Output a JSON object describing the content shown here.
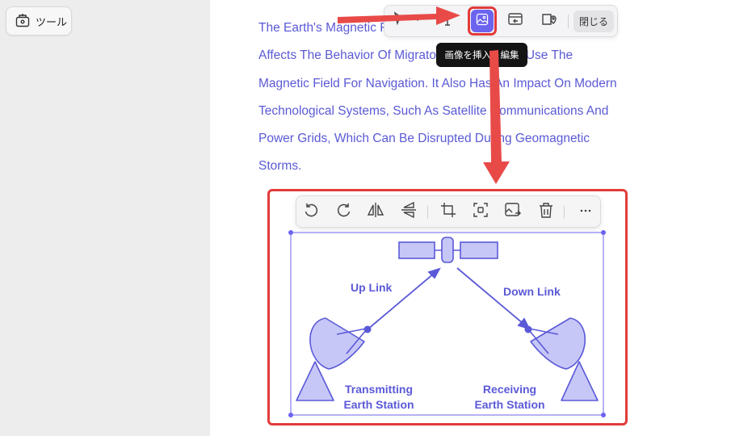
{
  "sidebar": {
    "tools_label": "ツール"
  },
  "document": {
    "paragraph_lines": [
      "The Earth's Magnetic Field Is Also Important Because It",
      "Affects The Behavior Of Migratory Animals That Use The",
      "Magnetic Field For Navigation. It Also Has An Impact On Modern",
      "Technological Systems, Such As Satellite Communications And",
      "Power Grids, Which Can Be Disrupted During Geomagnetic",
      "Storms."
    ]
  },
  "top_toolbar": {
    "tools": [
      "select-icon",
      "text-icon",
      "image-icon",
      "link-icon",
      "location-pin-icon"
    ],
    "close_label": "閉じる"
  },
  "tooltip": {
    "text": "画像を挿入＆編集"
  },
  "image_toolbar": {
    "tools": [
      "rotate-left-icon",
      "rotate-right-icon",
      "flip-horizontal-icon",
      "flip-vertical-icon",
      "crop-icon",
      "extract-icon",
      "replace-icon",
      "delete-icon",
      "more-icon"
    ]
  },
  "diagram": {
    "uplink_label": "Up Link",
    "downlink_label": "Down Link",
    "transmitting_line1": "Transmitting",
    "transmitting_line2": "Earth Station",
    "receiving_line1": "Receiving",
    "receiving_line2": "Earth Station"
  },
  "colors": {
    "accent_purple": "#6c63ef",
    "text_link": "#5a5ad6",
    "highlight_red": "#e23b3b",
    "diagram_fill": "#c6c7f7",
    "diagram_stroke": "#5b59d8"
  }
}
